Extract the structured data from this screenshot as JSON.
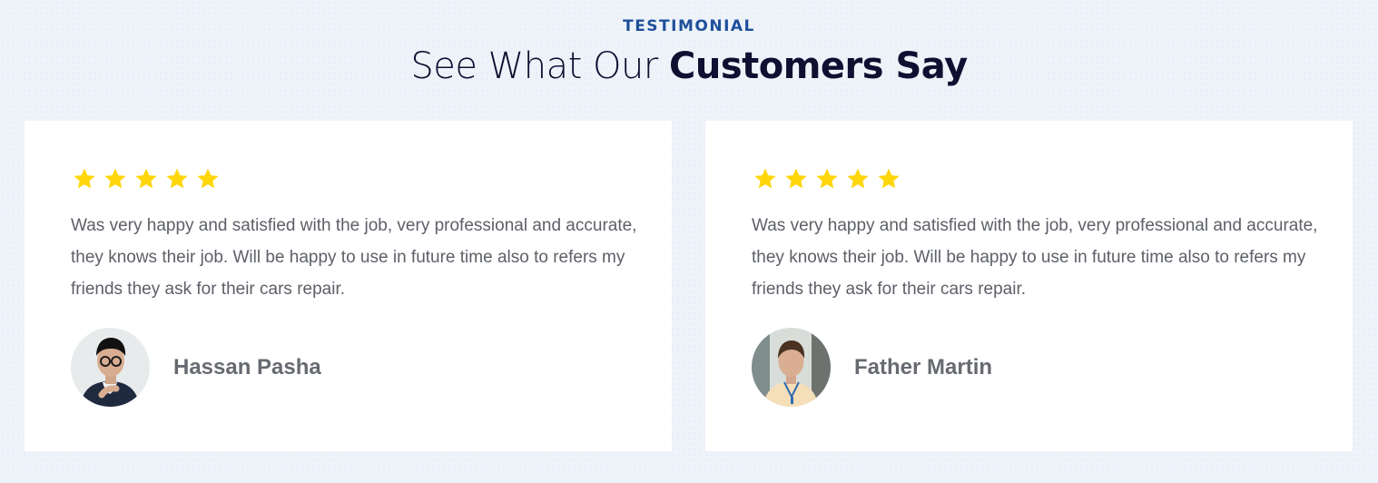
{
  "section": {
    "eyebrow": "TESTIMONIAL",
    "title_part1": "See What Our",
    "title_part2": "Customers Say"
  },
  "testimonials": [
    {
      "rating": 5,
      "quote": "Was very happy and satisfied with the job, very professional and accurate, they knows their job. Will be happy to use in future time also to refers my friends they ask for their cars repair.",
      "name": "Hassan Pasha",
      "avatar_icon": "man-portrait-avatar"
    },
    {
      "rating": 5,
      "quote": "Was very happy and satisfied with the job, very professional and accurate, they knows their job. Will be happy to use in future time also to refers my friends they ask for their cars repair.",
      "name": "Father Martin",
      "avatar_icon": "woman-portrait-avatar"
    }
  ],
  "colors": {
    "background": "#eef3fa",
    "card": "#ffffff",
    "eyebrow": "#1f4f9a",
    "title": "#0d1030",
    "text": "#5d6068",
    "star": "#ffd60a"
  }
}
